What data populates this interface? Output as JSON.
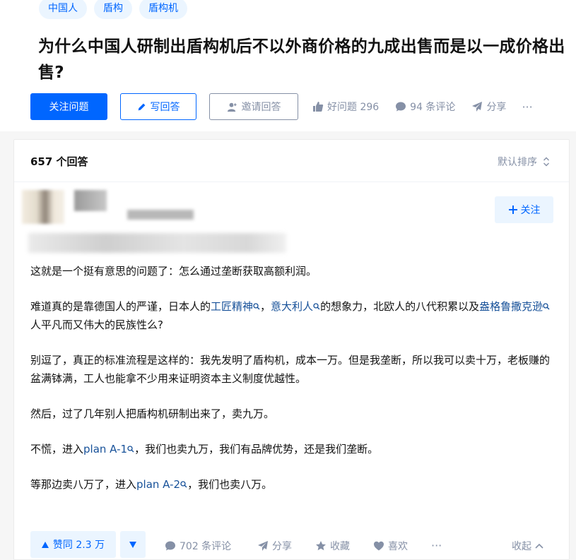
{
  "header": {
    "tags": [
      "中国人",
      "盾构",
      "盾构机"
    ],
    "title": "为什么中国人研制出盾构机后不以外商价格的九成出售而是以一成价格出售?",
    "follow_btn": "关注问题",
    "write_btn": "写回答",
    "invite_btn": "邀请回答",
    "good_q": "好问题 296",
    "comments": "94 条评论",
    "share": "分享",
    "more": "···"
  },
  "answers": {
    "count": "657 个回答",
    "sort": "默认排序",
    "follow_author": "关注"
  },
  "answer": {
    "p1": "这就是一个挺有意思的问题了：怎么通过垄断获取高额利润。",
    "p2a": "难道真的是靠德国人的严谨，日本人的",
    "link1": "工匠精神",
    "p2b": "，",
    "link2": "意大利人",
    "p2c": "的想象力，北欧人的八代积累以及",
    "link3": "盎格鲁撒克逊",
    "p2d": "人平凡而又伟大的民族性么?",
    "p3": "别逗了，真正的标准流程是这样的：我先发明了盾构机，成本一万。但是我垄断，所以我可以卖十万，老板赚的盆满钵满，工人也能拿不少用来证明资本主义制度优越性。",
    "p4": "然后，过了几年别人把盾构机研制出来了，卖九万。",
    "p5a": "不慌，进入",
    "link4": "plan A-1",
    "p5b": "，我们也卖九万，我们有品牌优势，还是我们垄断。",
    "p6a": "等那边卖八万了，进入",
    "link5": "plan A-2",
    "p6b": "，我们也卖八万。"
  },
  "bottom": {
    "vote": "赞同 2.3 万",
    "comments": "702 条评论",
    "share": "分享",
    "collect": "收藏",
    "like": "喜欢",
    "more": "···",
    "collapse": "收起"
  }
}
